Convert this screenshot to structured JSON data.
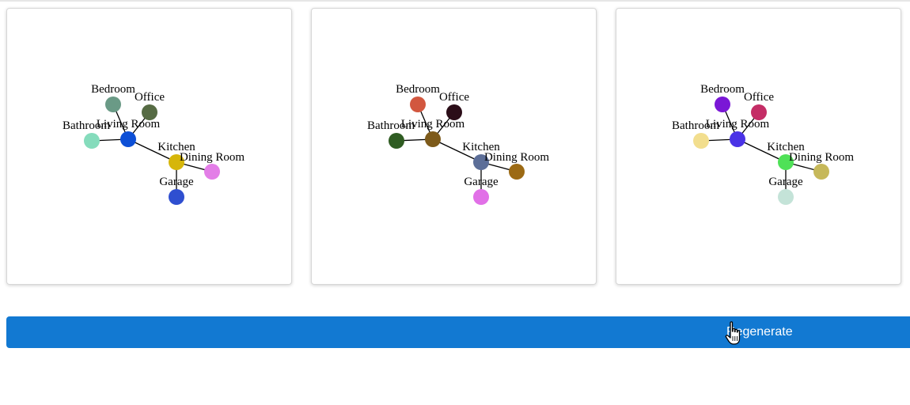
{
  "diagram": {
    "rooms": [
      "Bedroom",
      "Office",
      "Bathroom",
      "Living Room",
      "Kitchen",
      "Dining Room",
      "Garage"
    ],
    "connections": [
      [
        "Bedroom",
        "Living Room"
      ],
      [
        "Office",
        "Living Room"
      ],
      [
        "Bathroom",
        "Living Room"
      ],
      [
        "Living Room",
        "Kitchen"
      ],
      [
        "Kitchen",
        "Dining Room"
      ],
      [
        "Kitchen",
        "Garage"
      ]
    ],
    "layouts": [
      {
        "colors": {
          "Bedroom": "#6a9a86",
          "Office": "#566b44",
          "Bathroom": "#85dcbc",
          "Living Room": "#0d4fd6",
          "Kitchen": "#d6b60a",
          "Dining Room": "#e37ee7",
          "Garage": "#2f4fd0"
        }
      },
      {
        "colors": {
          "Bedroom": "#d2573f",
          "Office": "#2b0d18",
          "Bathroom": "#2f5c22",
          "Living Room": "#7d5a1a",
          "Kitchen": "#5c6e98",
          "Dining Room": "#9c6a14",
          "Garage": "#e170e7"
        }
      },
      {
        "colors": {
          "Bedroom": "#7a17d6",
          "Office": "#c42d66",
          "Bathroom": "#f2de8e",
          "Living Room": "#4a33e6",
          "Kitchen": "#4fe157",
          "Dining Room": "#c6b85a",
          "Garage": "#c4e3d8"
        }
      }
    ]
  },
  "controls": {
    "regenerate_label": "Regenerate"
  }
}
